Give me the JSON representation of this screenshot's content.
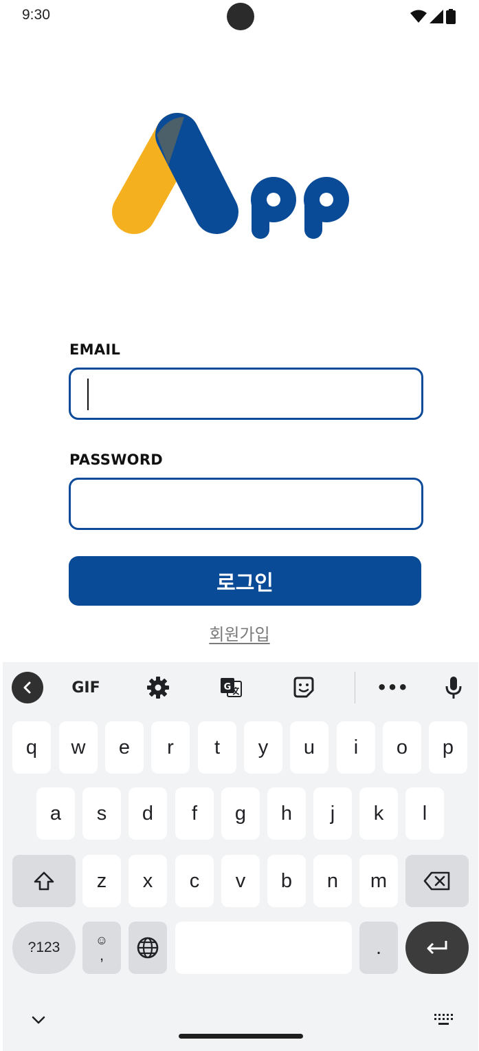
{
  "status_bar": {
    "time": "9:30"
  },
  "logo": {
    "text": "App",
    "colors": {
      "primary": "#0a4b98",
      "accent": "#f5b01f"
    }
  },
  "form": {
    "email_label": "EMAIL",
    "email_value": "",
    "password_label": "PASSWORD",
    "password_value": "",
    "login_label": "로그인",
    "signup_label": "회원가입"
  },
  "keyboard": {
    "toolbar": {
      "gif_label": "GIF",
      "more_label": "•••"
    },
    "row1": [
      "q",
      "w",
      "e",
      "r",
      "t",
      "y",
      "u",
      "i",
      "o",
      "p"
    ],
    "row2": [
      "a",
      "s",
      "d",
      "f",
      "g",
      "h",
      "j",
      "k",
      "l"
    ],
    "row3": [
      "z",
      "x",
      "c",
      "v",
      "b",
      "n",
      "m"
    ],
    "symbols_label": "?123",
    "period_label": ".",
    "comma_label": ","
  },
  "colors": {
    "accent": "#0a4b98",
    "keyboard_bg": "#f1f3f4",
    "special_key": "#dadce0"
  }
}
